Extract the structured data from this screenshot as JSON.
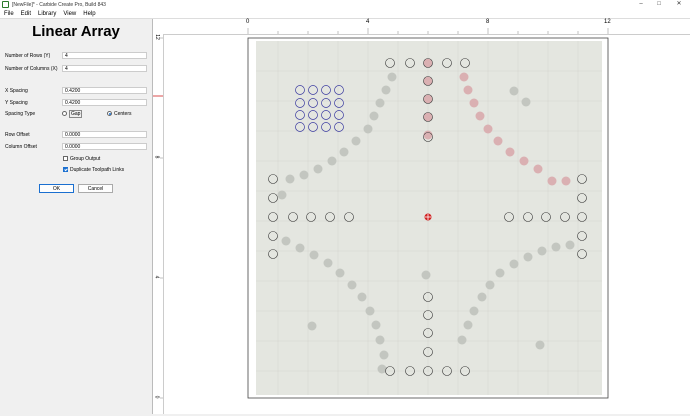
{
  "window": {
    "title": "[NewFile]* - Carbide Create Pro, Build 843"
  },
  "menu": [
    "File",
    "Edit",
    "Library",
    "View",
    "Help"
  ],
  "panel": {
    "title": "Linear Array",
    "rows_label": "Number of Rows (Y)",
    "rows_value": "4",
    "cols_label": "Number of Columns (X)",
    "cols_value": "4",
    "xspacing_label": "X Spacing",
    "xspacing_value": "0.4200",
    "yspacing_label": "Y Spacing",
    "yspacing_value": "0.4200",
    "spacing_type_label": "Spacing Type",
    "gap_label": "Gap",
    "centers_label": "Centers",
    "row_offset_label": "Row Offset",
    "row_offset_value": "0.0000",
    "col_offset_label": "Column Offset",
    "col_offset_value": "0.0000",
    "group_output_label": "Group Output",
    "dup_links_label": "Duplicate Toolpath Links",
    "ok_label": "OK",
    "cancel_label": "Cancel"
  },
  "ruler": {
    "top": [
      "0",
      "4",
      "8",
      "12"
    ],
    "left": [
      "12",
      "8",
      "4",
      "0"
    ]
  },
  "colors": {
    "accent": "#1a6fd0",
    "selection": "#3a3aa0",
    "origin": "#d02020"
  }
}
